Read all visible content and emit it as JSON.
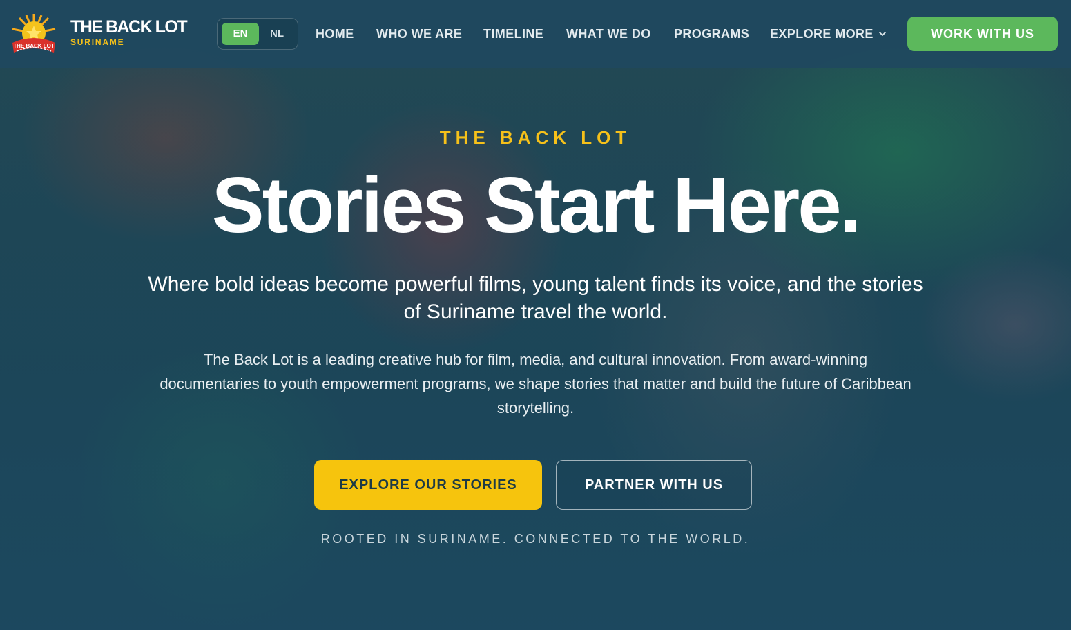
{
  "brand": {
    "title": "THE BACK LOT",
    "subtitle": "SURINAME",
    "badge_text": "THE BACK LOT",
    "logo_icon": "star-logo-icon"
  },
  "language": {
    "options": [
      "EN",
      "NL"
    ],
    "selected": "EN"
  },
  "nav": {
    "items": [
      {
        "label": "HOME"
      },
      {
        "label": "WHO WE ARE"
      },
      {
        "label": "TIMELINE"
      },
      {
        "label": "WHAT WE DO"
      },
      {
        "label": "PROGRAMS"
      },
      {
        "label": "EXPLORE MORE"
      }
    ],
    "explore_icon": "chevron-down-icon",
    "cta_label": "WORK WITH US"
  },
  "hero": {
    "kicker": "THE BACK LOT",
    "headline": "Stories Start Here.",
    "subhead": "Where bold ideas become powerful films, young talent finds its voice, and the stories of Suriname travel the world.",
    "body": "The Back Lot is a leading creative hub for film, media, and cultural innovation. From award-winning documentaries to youth empowerment programs, we shape stories that matter and build the future of Caribbean storytelling.",
    "primary_button": "EXPLORE OUR STORIES",
    "secondary_button": "PARTNER WITH US",
    "tagline": "ROOTED IN SURINAME. CONNECTED TO THE WORLD."
  },
  "colors": {
    "accent_yellow": "#f6c40d",
    "accent_green": "#5cb85c",
    "nav_bg": "#1f485f"
  }
}
